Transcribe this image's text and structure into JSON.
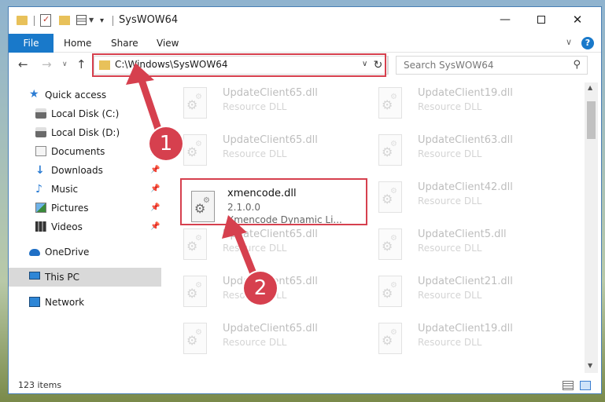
{
  "window": {
    "title": "SysWOW64",
    "minimize_icon": "minimize-icon",
    "maximize_icon": "maximize-icon",
    "close_icon": "close-icon"
  },
  "quick_access_toolbar": {
    "icons": [
      "folder-icon",
      "properties-icon",
      "new-folder-icon",
      "view-icon",
      "customize-chevron-icon"
    ]
  },
  "ribbon": {
    "tabs": [
      {
        "label": "File",
        "active": true
      },
      {
        "label": "Home"
      },
      {
        "label": "Share"
      },
      {
        "label": "View"
      }
    ],
    "help_label": "?",
    "accent": "#1979ca"
  },
  "navigation": {
    "address": "C:\\Windows\\SysWOW64",
    "search_placeholder": "Search SysWOW64"
  },
  "sidebar": {
    "items": [
      {
        "label": "Quick access",
        "icon": "star-icon"
      },
      {
        "label": "Local Disk (C:)",
        "icon": "drive-icon"
      },
      {
        "label": "Local Disk (D:)",
        "icon": "drive-icon"
      },
      {
        "label": "Documents",
        "icon": "documents-icon",
        "pinned": true
      },
      {
        "label": "Downloads",
        "icon": "download-icon",
        "pinned": true
      },
      {
        "label": "Music",
        "icon": "music-icon",
        "pinned": true
      },
      {
        "label": "Pictures",
        "icon": "pictures-icon",
        "pinned": true
      },
      {
        "label": "Videos",
        "icon": "videos-icon",
        "pinned": true
      },
      {
        "label": "OneDrive",
        "icon": "cloud-icon"
      },
      {
        "label": "This PC",
        "icon": "computer-icon",
        "selected": true
      },
      {
        "label": "Network",
        "icon": "network-icon"
      }
    ]
  },
  "files": {
    "left": [
      {
        "name": "UpdateClient65.dll",
        "line2": "Resource DLL",
        "line3": ""
      },
      {
        "name": "UpdateClient65.dll",
        "line2": "Resource DLL",
        "line3": ""
      },
      {
        "name": "xmencode.dll",
        "line2": "2.1.0.0",
        "line3": "Xmencode Dynamic Li...",
        "active": true
      },
      {
        "name": "UpdateClient65.dll",
        "line2": "Resource DLL",
        "line3": ""
      },
      {
        "name": "UpdateClient65.dll",
        "line2": "Resource DLL",
        "line3": ""
      },
      {
        "name": "UpdateClient65.dll",
        "line2": "Resource DLL",
        "line3": ""
      }
    ],
    "right": [
      {
        "name": "UpdateClient19.dll",
        "line2": "Resource DLL"
      },
      {
        "name": "UpdateClient63.dll",
        "line2": "Resource DLL"
      },
      {
        "name": "UpdateClient42.dll",
        "line2": "Resource DLL"
      },
      {
        "name": "UpdateClient5.dll",
        "line2": "Resource DLL"
      },
      {
        "name": "UpdateClient21.dll",
        "line2": "Resource DLL"
      },
      {
        "name": "UpdateClient19.dll",
        "line2": "Resource DLL"
      }
    ]
  },
  "status_bar": {
    "item_count": "123 items"
  },
  "annotations": {
    "badge_1": "1",
    "badge_2": "2",
    "color": "#d6404e"
  }
}
